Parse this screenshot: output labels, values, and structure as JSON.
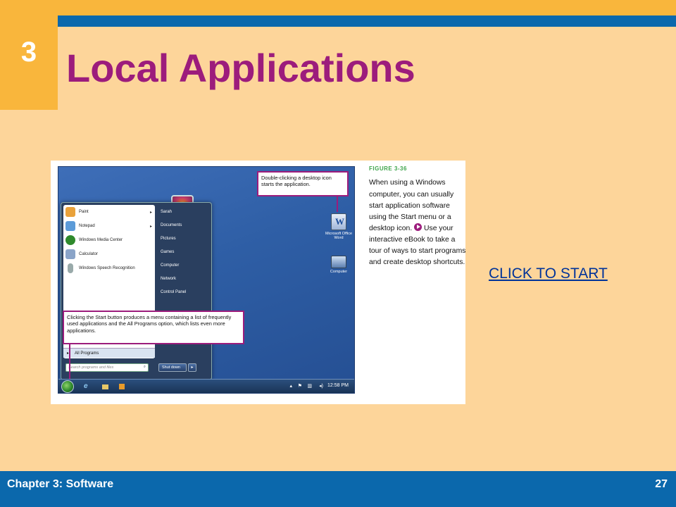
{
  "slide": {
    "number": "3",
    "title": "Local Applications",
    "link_text": "CLICK TO START",
    "footer_left": "Chapter 3: Software",
    "footer_right": "27"
  },
  "colors": {
    "background": "#FDD59A",
    "accent_orange": "#F9B63C",
    "accent_blue": "#0B68AC",
    "title_magenta": "#9C1C7C",
    "link_blue": "#003399"
  },
  "figure": {
    "label": "FIGURE 3-36",
    "caption_part1": "When using a Windows computer, you can usually start application software using the Start menu or a desktop icon.",
    "caption_part2": "Use your interactive eBook to take a tour of ways to start programs and create desktop shortcuts.",
    "callout_top": "Double-clicking a desktop icon starts the application.",
    "callout_bottom": "Clicking the Start button produces a menu containing a list of frequently used applications and the All Programs option, which lists even more applications."
  },
  "start_menu": {
    "programs": [
      {
        "label": "Paint",
        "icon": "paint-icon",
        "color": "#e9a23b",
        "submenu": true
      },
      {
        "label": "Notepad",
        "icon": "notepad-icon",
        "color": "#5c9bd8",
        "submenu": true
      },
      {
        "label": "Windows Media Center",
        "icon": "media-center-icon",
        "color": "#2f8a2c",
        "submenu": false
      },
      {
        "label": "Calculator",
        "icon": "calculator-icon",
        "color": "#8aa4c8",
        "submenu": false
      },
      {
        "label": "Windows Speech Recognition",
        "icon": "microphone-icon",
        "color": "#9aa",
        "submenu": false
      }
    ],
    "all_programs": "All Programs",
    "search_placeholder": "Search programs and files",
    "right_items": [
      "Sarah",
      "Documents",
      "Pictures",
      "Games",
      "Computer",
      "Network",
      "Control Panel"
    ],
    "shutdown": "Shut down"
  },
  "desktop_icons": [
    {
      "label": "Microsoft Office Word",
      "icon": "word-icon"
    },
    {
      "label": "Computer",
      "icon": "computer-icon"
    }
  ],
  "taskbar": {
    "clock": "12:58 PM"
  }
}
